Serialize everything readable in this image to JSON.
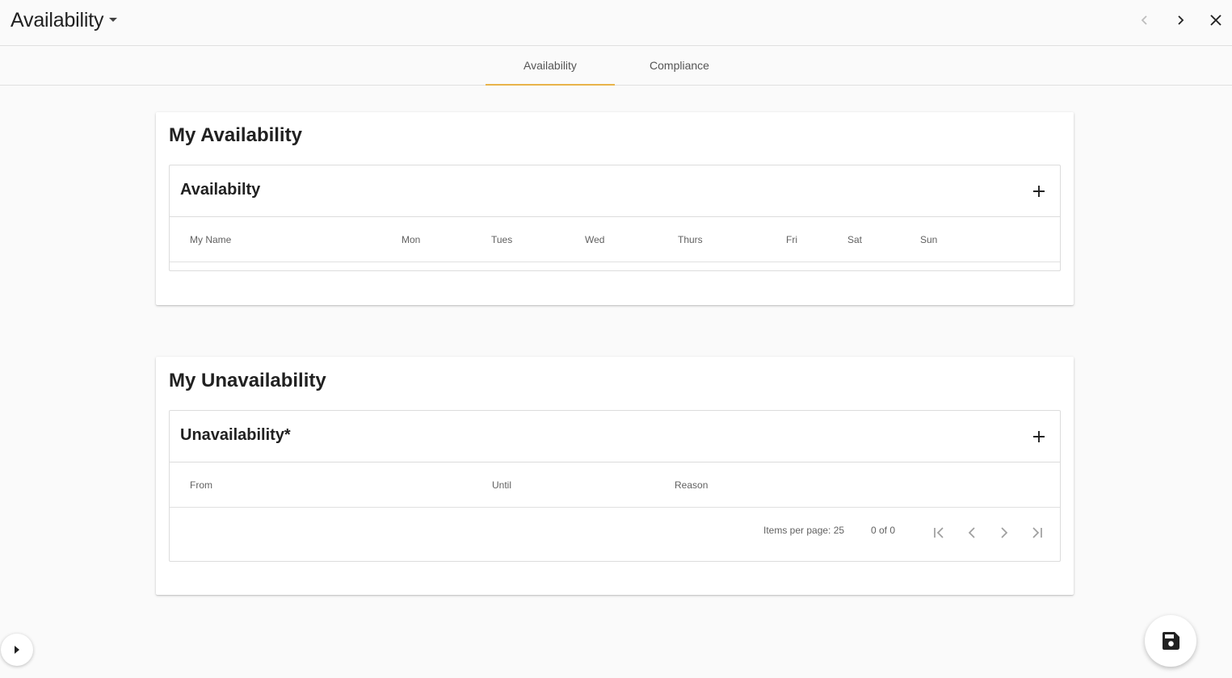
{
  "header": {
    "title": "Availability",
    "icons": {
      "dropdown": "caret-down-icon",
      "prev": "chevron-left-icon",
      "next": "chevron-right-icon",
      "close": "close-icon"
    }
  },
  "tabs": [
    {
      "label": "Availability",
      "active": true
    },
    {
      "label": "Compliance",
      "active": false
    }
  ],
  "availability_card": {
    "title": "My Availability",
    "panel_title": "Availabilty",
    "add_icon": "plus-icon",
    "columns": [
      "My Name",
      "Mon",
      "Tues",
      "Wed",
      "Thurs",
      "Fri",
      "Sat",
      "Sun"
    ],
    "rows": []
  },
  "unavailability_card": {
    "title": "My Unavailability",
    "panel_title": "Unavailability*",
    "add_icon": "plus-icon",
    "columns": [
      "From",
      "Until",
      "Reason"
    ],
    "rows": [],
    "paginator": {
      "items_per_page": "Items per page: 25",
      "range": "0 of 0"
    }
  },
  "floating": {
    "side_toggle_icon": "caret-right-icon",
    "save_icon": "floppy-disk-icon"
  },
  "colors": {
    "accent": "#e8b34a",
    "background": "#fafafa",
    "card": "#ffffff",
    "border": "#dcdcdc"
  }
}
